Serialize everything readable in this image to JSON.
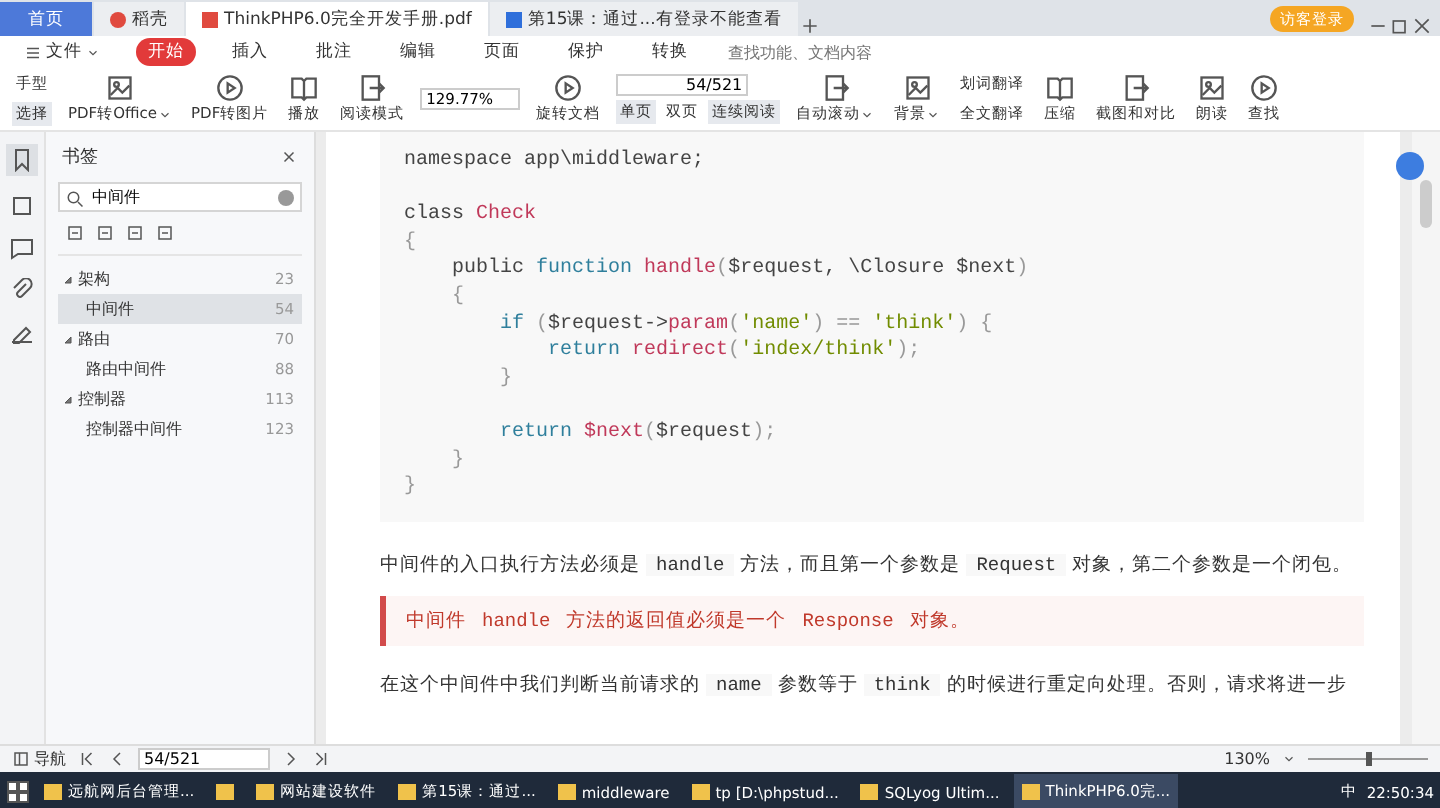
{
  "tabs": [
    {
      "label": "首页",
      "kind": "home",
      "selected": false
    },
    {
      "label": "稻壳",
      "kind": "doc",
      "selected": false
    },
    {
      "label": "ThinkPHP6.0完全开发手册.pdf",
      "kind": "pdf",
      "selected": true
    },
    {
      "label": "第15课：通过...有登录不能查看",
      "kind": "web",
      "selected": false
    }
  ],
  "login_button": "访客登录",
  "menu": {
    "file": "文件",
    "items": [
      {
        "label": "开始",
        "selected": true
      },
      {
        "label": "插入",
        "selected": false
      },
      {
        "label": "批注",
        "selected": false
      },
      {
        "label": "编辑",
        "selected": false
      },
      {
        "label": "页面",
        "selected": false
      },
      {
        "label": "保护",
        "selected": false
      },
      {
        "label": "转换",
        "selected": false
      }
    ],
    "search_placeholder": "查找功能、文档内容"
  },
  "toolbar": [
    {
      "kind": "stack",
      "items": [
        {
          "label": "手型",
          "selected": false
        },
        {
          "label": "选择",
          "selected": true
        }
      ]
    },
    {
      "kind": "big",
      "label": "PDF转Office",
      "dropdown": true
    },
    {
      "kind": "big",
      "label": "PDF转图片",
      "dropdown": false
    },
    {
      "kind": "big",
      "label": "播放",
      "dropdown": false
    },
    {
      "kind": "big",
      "label": "阅读模式",
      "dropdown": false
    },
    {
      "kind": "zoom",
      "value": "129.77%"
    },
    {
      "kind": "big",
      "label": "旋转文档",
      "dropdown": false
    },
    {
      "kind": "pager",
      "value": "54/521",
      "items": [
        {
          "label": "单页",
          "selected": true
        },
        {
          "label": "双页",
          "selected": false
        },
        {
          "label": "连续阅读",
          "selected": true
        }
      ]
    },
    {
      "kind": "big",
      "label": "自动滚动",
      "dropdown": true
    },
    {
      "kind": "big",
      "label": "背景",
      "dropdown": true
    },
    {
      "kind": "stack",
      "items": [
        {
          "label": "划词翻译",
          "selected": false
        },
        {
          "label": "全文翻译",
          "selected": false
        }
      ]
    },
    {
      "kind": "big",
      "label": "压缩",
      "dropdown": false
    },
    {
      "kind": "big",
      "label": "截图和对比",
      "dropdown": false
    },
    {
      "kind": "big",
      "label": "朗读",
      "dropdown": false
    },
    {
      "kind": "big",
      "label": "查找",
      "dropdown": false
    }
  ],
  "bookmarks": {
    "title": "书签",
    "search_value": "中间件",
    "items": [
      {
        "label": "架构",
        "page": "23",
        "expanded": true,
        "selected": false,
        "children": [
          {
            "label": "中间件",
            "page": "54",
            "selected": true
          }
        ]
      },
      {
        "label": "路由",
        "page": "70",
        "expanded": true,
        "selected": false,
        "children": [
          {
            "label": "路由中间件",
            "page": "88",
            "selected": false
          }
        ]
      },
      {
        "label": "控制器",
        "page": "113",
        "expanded": true,
        "selected": false,
        "children": [
          {
            "label": "控制器中间件",
            "page": "123",
            "selected": false
          }
        ]
      }
    ]
  },
  "code": [
    {
      "space_after": true,
      "tokens": [
        {
          "text": "namespace app\\middleware;",
          "kind": "plain"
        }
      ]
    },
    {
      "space_after": false,
      "tokens": [
        {
          "text": "class ",
          "kind": "plain"
        },
        {
          "text": "Check",
          "kind": "name"
        }
      ]
    },
    {
      "space_after": false,
      "tokens": [
        {
          "text": "{",
          "kind": "punct"
        }
      ]
    },
    {
      "space_after": false,
      "tokens": [
        {
          "text": "    public ",
          "kind": "plain"
        },
        {
          "text": "function ",
          "kind": "keyword"
        },
        {
          "text": "handle",
          "kind": "name"
        },
        {
          "text": "(",
          "kind": "punct"
        },
        {
          "text": "$request, \\Closure $next",
          "kind": "plain"
        },
        {
          "text": ")",
          "kind": "punct"
        }
      ]
    },
    {
      "space_after": false,
      "tokens": [
        {
          "text": "    {",
          "kind": "punct"
        }
      ]
    },
    {
      "space_after": false,
      "tokens": [
        {
          "text": "        if ",
          "kind": "keyword"
        },
        {
          "text": "(",
          "kind": "punct"
        },
        {
          "text": "$request->",
          "kind": "plain"
        },
        {
          "text": "param",
          "kind": "name"
        },
        {
          "text": "(",
          "kind": "punct"
        },
        {
          "text": "'name'",
          "kind": "string"
        },
        {
          "text": ") == ",
          "kind": "punct"
        },
        {
          "text": "'think'",
          "kind": "string"
        },
        {
          "text": ") {",
          "kind": "punct"
        }
      ]
    },
    {
      "space_after": false,
      "tokens": [
        {
          "text": "            return ",
          "kind": "keyword"
        },
        {
          "text": "redirect",
          "kind": "name"
        },
        {
          "text": "(",
          "kind": "punct"
        },
        {
          "text": "'index/think'",
          "kind": "string"
        },
        {
          "text": ");",
          "kind": "punct"
        }
      ]
    },
    {
      "space_after": true,
      "tokens": [
        {
          "text": "        }",
          "kind": "punct"
        }
      ]
    },
    {
      "space_after": false,
      "tokens": [
        {
          "text": "        return ",
          "kind": "keyword"
        },
        {
          "text": "$next",
          "kind": "name"
        },
        {
          "text": "(",
          "kind": "punct"
        },
        {
          "text": "$request",
          "kind": "plain"
        },
        {
          "text": ");",
          "kind": "punct"
        }
      ]
    },
    {
      "space_after": false,
      "tokens": [
        {
          "text": "    }",
          "kind": "punct"
        }
      ]
    },
    {
      "space_after": false,
      "tokens": [
        {
          "text": "}",
          "kind": "punct"
        }
      ]
    }
  ],
  "paragraph_1": [
    {
      "text": "中间件的入口执行方法必须是",
      "kind": "text"
    },
    {
      "text": "handle",
      "kind": "code"
    },
    {
      "text": "方法，而且第一个参数是",
      "kind": "text"
    },
    {
      "text": "Request",
      "kind": "code"
    },
    {
      "text": "对象，第二个参数是一个闭包。",
      "kind": "text"
    }
  ],
  "callout": [
    {
      "text": "中间件",
      "kind": "text"
    },
    {
      "text": "handle",
      "kind": "code"
    },
    {
      "text": "方法的返回值必须是一个",
      "kind": "text"
    },
    {
      "text": "Response",
      "kind": "code"
    },
    {
      "text": "对象。",
      "kind": "text"
    }
  ],
  "paragraph_2": [
    {
      "text": "在这个中间件中我们判断当前请求的",
      "kind": "text"
    },
    {
      "text": "name",
      "kind": "code"
    },
    {
      "text": "参数等于",
      "kind": "text"
    },
    {
      "text": "think",
      "kind": "code"
    },
    {
      "text": "的时候进行重定向处理。否则，请求将进一步",
      "kind": "text"
    }
  ],
  "status_bar": {
    "nav": "导航",
    "page": "54/521",
    "zoom": "130%",
    "zoom_slider": {
      "level": 0.5
    }
  },
  "taskbar": {
    "apps": [
      {
        "label": "远航网后台管理...",
        "active": false
      },
      {
        "active": false
      },
      {
        "label": "网站建设软件",
        "active": false
      },
      {
        "label": "第15课：通过...",
        "active": false
      },
      {
        "label": "middleware",
        "active": false
      },
      {
        "label": "tp [D:\\phpstud...",
        "active": false
      },
      {
        "label": "SQLyog Ultim...",
        "active": false
      },
      {
        "label": "ThinkPHP6.0完...",
        "active": true
      }
    ],
    "ime": "中",
    "time": "22:50:34"
  }
}
